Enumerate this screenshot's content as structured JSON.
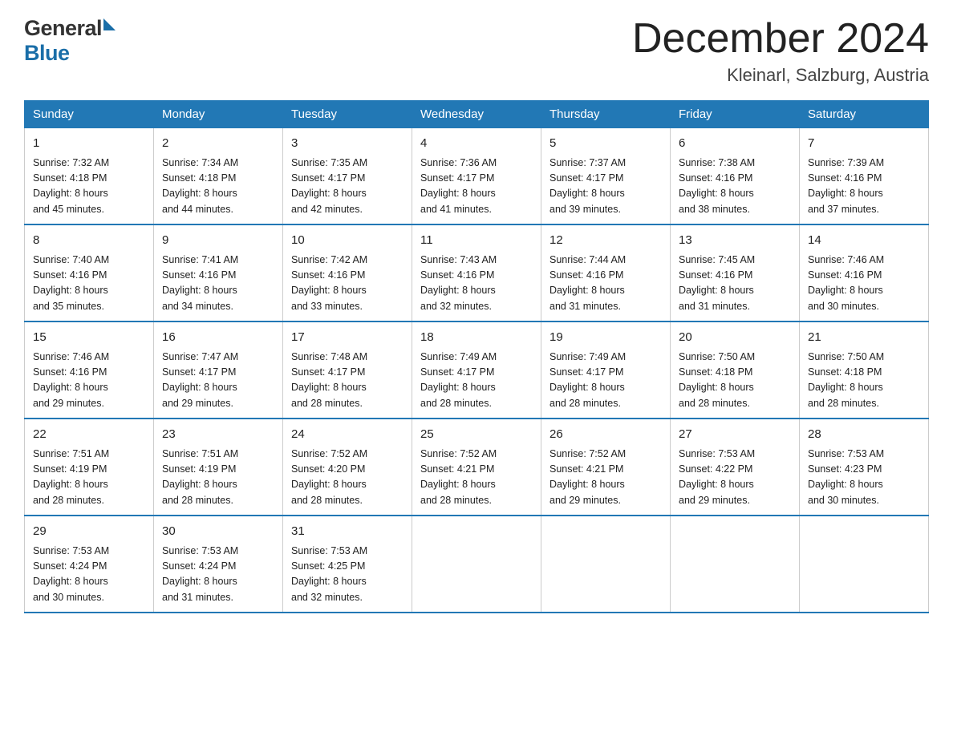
{
  "header": {
    "logo_general": "General",
    "logo_blue": "Blue",
    "month_title": "December 2024",
    "location": "Kleinarl, Salzburg, Austria"
  },
  "days_of_week": [
    "Sunday",
    "Monday",
    "Tuesday",
    "Wednesday",
    "Thursday",
    "Friday",
    "Saturday"
  ],
  "weeks": [
    [
      {
        "day": "1",
        "sunrise": "7:32 AM",
        "sunset": "4:18 PM",
        "daylight": "8 hours and 45 minutes."
      },
      {
        "day": "2",
        "sunrise": "7:34 AM",
        "sunset": "4:18 PM",
        "daylight": "8 hours and 44 minutes."
      },
      {
        "day": "3",
        "sunrise": "7:35 AM",
        "sunset": "4:17 PM",
        "daylight": "8 hours and 42 minutes."
      },
      {
        "day": "4",
        "sunrise": "7:36 AM",
        "sunset": "4:17 PM",
        "daylight": "8 hours and 41 minutes."
      },
      {
        "day": "5",
        "sunrise": "7:37 AM",
        "sunset": "4:17 PM",
        "daylight": "8 hours and 39 minutes."
      },
      {
        "day": "6",
        "sunrise": "7:38 AM",
        "sunset": "4:16 PM",
        "daylight": "8 hours and 38 minutes."
      },
      {
        "day": "7",
        "sunrise": "7:39 AM",
        "sunset": "4:16 PM",
        "daylight": "8 hours and 37 minutes."
      }
    ],
    [
      {
        "day": "8",
        "sunrise": "7:40 AM",
        "sunset": "4:16 PM",
        "daylight": "8 hours and 35 minutes."
      },
      {
        "day": "9",
        "sunrise": "7:41 AM",
        "sunset": "4:16 PM",
        "daylight": "8 hours and 34 minutes."
      },
      {
        "day": "10",
        "sunrise": "7:42 AM",
        "sunset": "4:16 PM",
        "daylight": "8 hours and 33 minutes."
      },
      {
        "day": "11",
        "sunrise": "7:43 AM",
        "sunset": "4:16 PM",
        "daylight": "8 hours and 32 minutes."
      },
      {
        "day": "12",
        "sunrise": "7:44 AM",
        "sunset": "4:16 PM",
        "daylight": "8 hours and 31 minutes."
      },
      {
        "day": "13",
        "sunrise": "7:45 AM",
        "sunset": "4:16 PM",
        "daylight": "8 hours and 31 minutes."
      },
      {
        "day": "14",
        "sunrise": "7:46 AM",
        "sunset": "4:16 PM",
        "daylight": "8 hours and 30 minutes."
      }
    ],
    [
      {
        "day": "15",
        "sunrise": "7:46 AM",
        "sunset": "4:16 PM",
        "daylight": "8 hours and 29 minutes."
      },
      {
        "day": "16",
        "sunrise": "7:47 AM",
        "sunset": "4:17 PM",
        "daylight": "8 hours and 29 minutes."
      },
      {
        "day": "17",
        "sunrise": "7:48 AM",
        "sunset": "4:17 PM",
        "daylight": "8 hours and 28 minutes."
      },
      {
        "day": "18",
        "sunrise": "7:49 AM",
        "sunset": "4:17 PM",
        "daylight": "8 hours and 28 minutes."
      },
      {
        "day": "19",
        "sunrise": "7:49 AM",
        "sunset": "4:17 PM",
        "daylight": "8 hours and 28 minutes."
      },
      {
        "day": "20",
        "sunrise": "7:50 AM",
        "sunset": "4:18 PM",
        "daylight": "8 hours and 28 minutes."
      },
      {
        "day": "21",
        "sunrise": "7:50 AM",
        "sunset": "4:18 PM",
        "daylight": "8 hours and 28 minutes."
      }
    ],
    [
      {
        "day": "22",
        "sunrise": "7:51 AM",
        "sunset": "4:19 PM",
        "daylight": "8 hours and 28 minutes."
      },
      {
        "day": "23",
        "sunrise": "7:51 AM",
        "sunset": "4:19 PM",
        "daylight": "8 hours and 28 minutes."
      },
      {
        "day": "24",
        "sunrise": "7:52 AM",
        "sunset": "4:20 PM",
        "daylight": "8 hours and 28 minutes."
      },
      {
        "day": "25",
        "sunrise": "7:52 AM",
        "sunset": "4:21 PM",
        "daylight": "8 hours and 28 minutes."
      },
      {
        "day": "26",
        "sunrise": "7:52 AM",
        "sunset": "4:21 PM",
        "daylight": "8 hours and 29 minutes."
      },
      {
        "day": "27",
        "sunrise": "7:53 AM",
        "sunset": "4:22 PM",
        "daylight": "8 hours and 29 minutes."
      },
      {
        "day": "28",
        "sunrise": "7:53 AM",
        "sunset": "4:23 PM",
        "daylight": "8 hours and 30 minutes."
      }
    ],
    [
      {
        "day": "29",
        "sunrise": "7:53 AM",
        "sunset": "4:24 PM",
        "daylight": "8 hours and 30 minutes."
      },
      {
        "day": "30",
        "sunrise": "7:53 AM",
        "sunset": "4:24 PM",
        "daylight": "8 hours and 31 minutes."
      },
      {
        "day": "31",
        "sunrise": "7:53 AM",
        "sunset": "4:25 PM",
        "daylight": "8 hours and 32 minutes."
      },
      null,
      null,
      null,
      null
    ]
  ],
  "labels": {
    "sunrise_prefix": "Sunrise: ",
    "sunset_prefix": "Sunset: ",
    "daylight_prefix": "Daylight: "
  }
}
